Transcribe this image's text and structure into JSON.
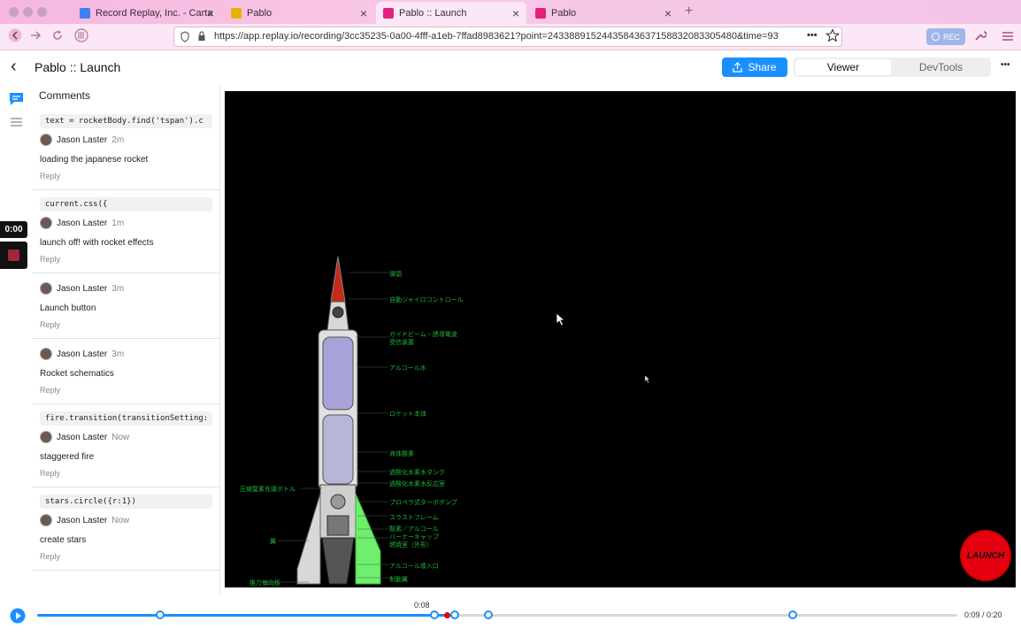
{
  "browser": {
    "tabs": [
      {
        "label": "Record Replay, Inc. - Carta",
        "close": "×"
      },
      {
        "label": "Pablo",
        "close": "×"
      },
      {
        "label": "Pablo :: Launch",
        "close": "×"
      },
      {
        "label": "Pablo",
        "close": "×"
      }
    ],
    "new_tab": "+",
    "url": "https://app.replay.io/recording/3cc35235-0a00-4fff-a1eb-7ffad8983621?point=24338891524435843637158832083305480&time=93",
    "rec_label": "REC",
    "more_label": "•••"
  },
  "app": {
    "back_icon": "‹",
    "title": "Pablo :: Launch",
    "share_label": "Share",
    "viewer_label": "Viewer",
    "devtools_label": "DevTools",
    "menu_label": "•••",
    "time_badge": "0:00"
  },
  "comments": {
    "header": "Comments",
    "items": [
      {
        "code": "text = rocketBody.find('tspan').c",
        "author": "Jason Laster",
        "time": "2m",
        "text": "loading the japanese rocket",
        "reply": "Reply"
      },
      {
        "code": "current.css({",
        "author": "Jason Laster",
        "time": "1m",
        "text": "launch off! with rocket effects",
        "reply": "Reply"
      },
      {
        "code": "",
        "author": "Jason Laster",
        "time": "3m",
        "text": "Launch button",
        "reply": "Reply"
      },
      {
        "code": "",
        "author": "Jason Laster",
        "time": "3m",
        "text": "Rocket schematics",
        "reply": "Reply"
      },
      {
        "code": "fire.transition(transitionSetting:",
        "author": "Jason Laster",
        "time": "Now",
        "text": "staggered fire",
        "reply": "Reply"
      },
      {
        "code": "stars.circle({r:1})",
        "author": "Jason Laster",
        "time": "Now",
        "text": "create stars",
        "reply": "Reply"
      }
    ]
  },
  "stage": {
    "labels": [
      "弾頭",
      "自動ジャイロコントロール",
      "ガイドビーム・誘導電波",
      "受信装置",
      "アルコール水",
      "ロケット本体",
      "液体酸素",
      "過酸化水素水タンク",
      "過酸化水素水反応室",
      "プロペラ式ターボポンプ",
      "スラストフレーム",
      "酸素／アルコール",
      "バーナーキャップ",
      "燃焼室（外形）",
      "アルコール導入口",
      "制動翼",
      "圧縮窒素充填ボトル",
      "翼",
      "推力偏向板"
    ],
    "launch_label": "LAUNCH"
  },
  "timeline": {
    "current_label": "0:08",
    "time_display": "0:09 / 0:20",
    "progress": 0.45
  },
  "colors": {
    "accent": "#1a90ff",
    "green": "#21b33a",
    "launch": "#e4000f"
  }
}
